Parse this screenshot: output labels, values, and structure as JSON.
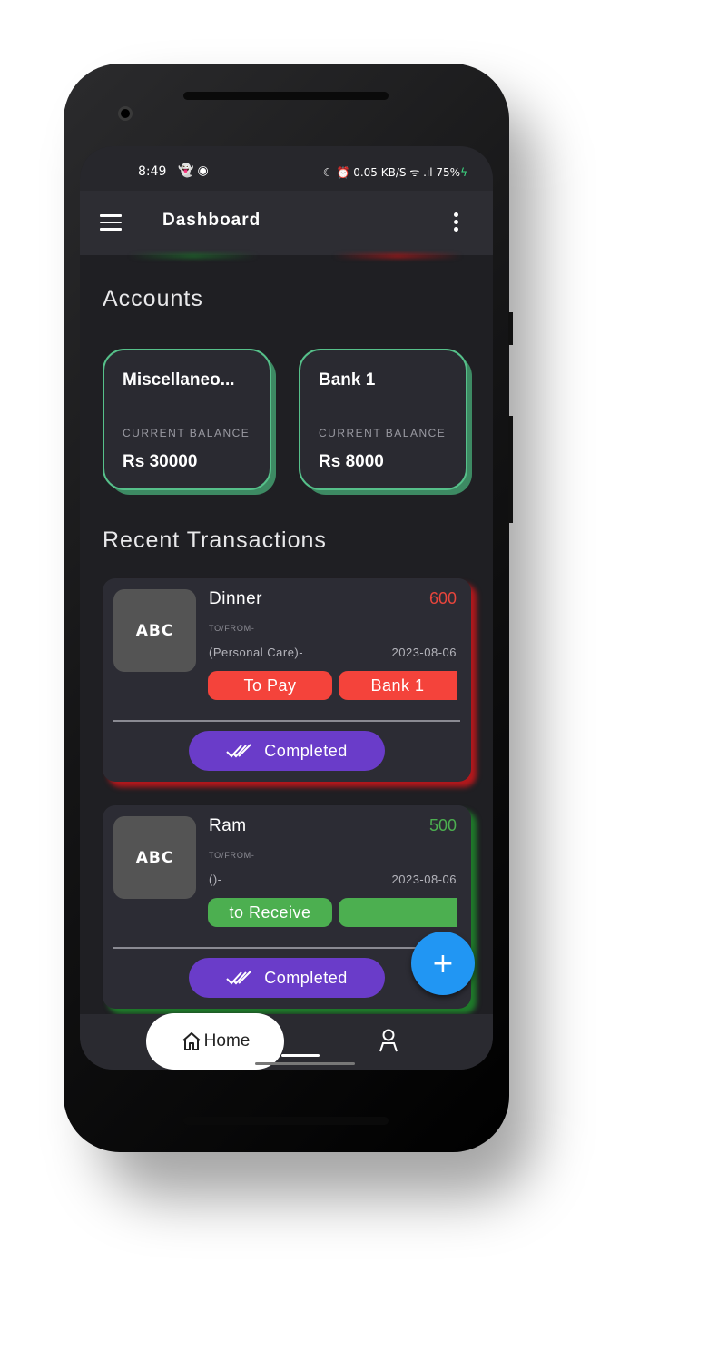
{
  "status_bar": {
    "time": "8:49",
    "left_icons": "snapchat-icon messenger-icon",
    "right_text": "☾ ⏰ 0.05 KB/S ᯤ .ıl 75%"
  },
  "appbar": {
    "title": "Dashboard"
  },
  "accounts": {
    "heading": "Accounts",
    "items": [
      {
        "name": "Miscellaneo...",
        "label": "CURRENT BALANCE",
        "balance": "Rs 30000"
      },
      {
        "name": "Bank 1",
        "label": "CURRENT BALANCE",
        "balance": "Rs 8000"
      }
    ]
  },
  "transactions": {
    "heading": "Recent Transactions",
    "items": [
      {
        "logo": "ABC",
        "name": "Dinner",
        "amount": "600",
        "to_from": "TO/FROM-",
        "category": "(Personal Care)-",
        "date": "2023-08-06",
        "tag1": "To Pay",
        "tag2": "Bank 1",
        "status": "Completed",
        "amount_color": "#e8453c",
        "tag_color": "#f4433b"
      },
      {
        "logo": "ABC",
        "name": "Ram",
        "amount": "500",
        "to_from": "TO/FROM-",
        "category": "()-",
        "date": "2023-08-06",
        "tag1": "to Receive",
        "tag2": "",
        "status": "Completed",
        "amount_color": "#4caf50",
        "tag_color": "#4caf50"
      }
    ]
  },
  "fab": {
    "label": "+"
  },
  "bottom_nav": {
    "home_label": "Home"
  }
}
